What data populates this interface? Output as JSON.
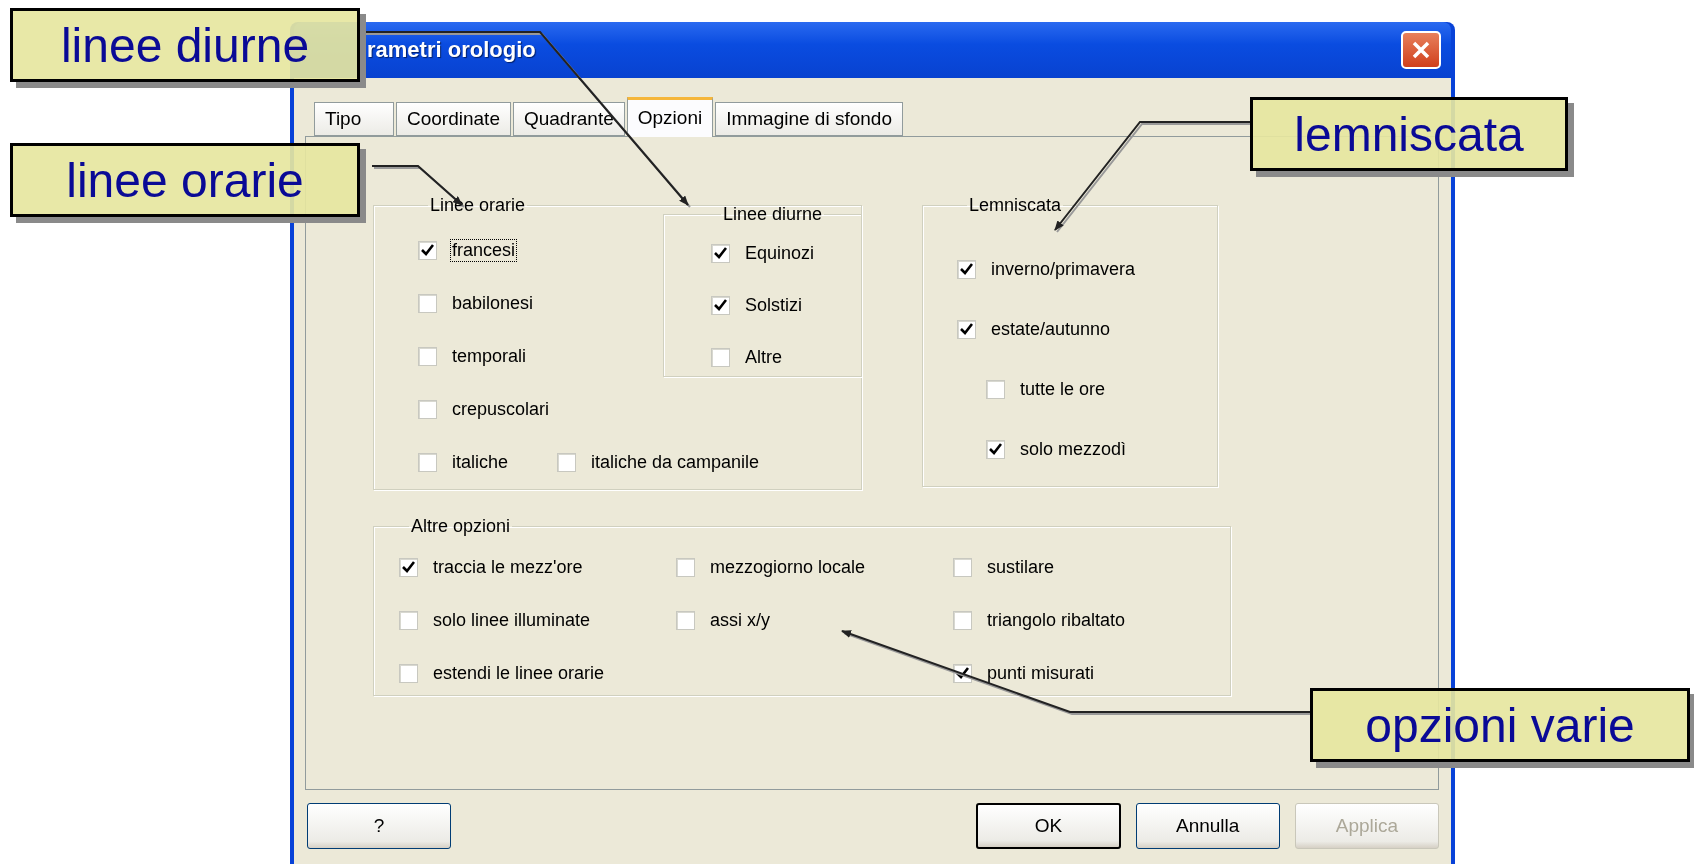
{
  "window": {
    "title": "rametri orologio"
  },
  "tabs": [
    {
      "label": "Tipo",
      "selected": false
    },
    {
      "label": "Coordinate",
      "selected": false
    },
    {
      "label": "Quadrante",
      "selected": false
    },
    {
      "label": "Opzioni",
      "selected": true
    },
    {
      "label": "Immagine di sfondo",
      "selected": false
    }
  ],
  "hour_lines": {
    "title": "Linee orarie",
    "options": [
      {
        "label": "francesi",
        "checked": true,
        "focused": true
      },
      {
        "label": "babilonesi",
        "checked": false,
        "focused": false
      },
      {
        "label": "temporali",
        "checked": false,
        "focused": false
      },
      {
        "label": "crepuscolari",
        "checked": false,
        "focused": false
      },
      {
        "label": "italiche",
        "checked": false,
        "focused": false
      },
      {
        "label": "italiche da campanile",
        "checked": false,
        "focused": false
      }
    ]
  },
  "day_lines": {
    "title": "Linee diurne",
    "options": [
      {
        "label": "Equinozi",
        "checked": true
      },
      {
        "label": "Solstizi",
        "checked": true
      },
      {
        "label": "Altre",
        "checked": false
      }
    ]
  },
  "lemniscate": {
    "title": "Lemniscata",
    "options": [
      {
        "label": "inverno/primavera",
        "checked": true
      },
      {
        "label": "estate/autunno",
        "checked": true,
        "children": [
          {
            "label": "tutte le ore",
            "checked": false
          },
          {
            "label": "solo mezzodì",
            "checked": true
          }
        ]
      }
    ]
  },
  "other_options": {
    "title": "Altre opzioni",
    "columns": [
      [
        {
          "label": "traccia le mezz'ore",
          "checked": true
        },
        {
          "label": "solo linee illuminate",
          "checked": false
        },
        {
          "label": "estendi le linee orarie",
          "checked": false
        }
      ],
      [
        {
          "label": "mezzogiorno locale",
          "checked": false
        },
        {
          "label": "assi x/y",
          "checked": false
        }
      ],
      [
        {
          "label": "sustilare",
          "checked": false
        },
        {
          "label": "triangolo ribaltato",
          "checked": false
        },
        {
          "label": "punti misurati",
          "checked": true
        }
      ]
    ]
  },
  "buttons": [
    {
      "label": "?",
      "default": false,
      "disabled": false
    },
    {
      "label": "OK",
      "default": true,
      "disabled": false
    },
    {
      "label": "Annulla",
      "default": false,
      "disabled": false
    },
    {
      "label": "Applica",
      "default": false,
      "disabled": true
    }
  ],
  "callouts": [
    {
      "label": "linee diurne"
    },
    {
      "label": "linee orarie"
    },
    {
      "label": "lemniscata"
    },
    {
      "label": "opzioni varie"
    }
  ]
}
